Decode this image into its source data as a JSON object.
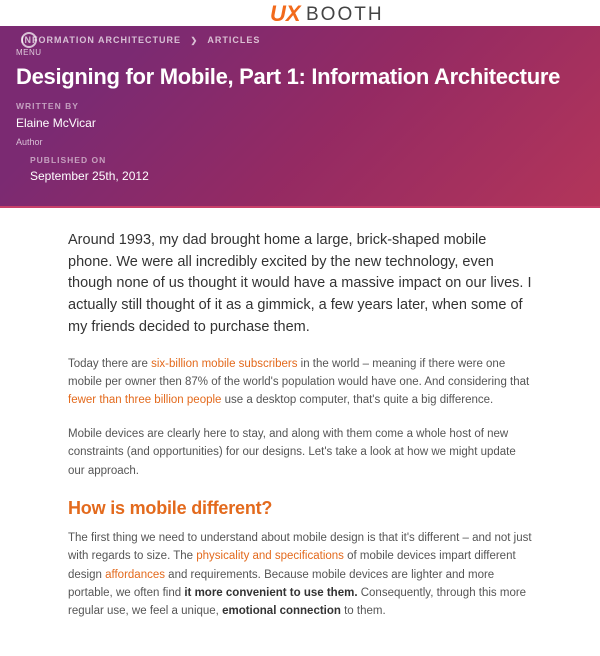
{
  "logo": {
    "mark": "UX",
    "word": "BOOTH"
  },
  "menu": {
    "label": "MENU"
  },
  "breadcrumb": {
    "items": [
      "INFORMATION ARCHITECTURE",
      "ARTICLES"
    ],
    "sep": "❯"
  },
  "title": "Designing for Mobile, Part 1: Information Architecture",
  "meta": {
    "written_by_label": "WRITTEN BY",
    "author_name": "Elaine McVicar",
    "author_role": "Author",
    "published_on_label": "PUBLISHED ON",
    "published_date": "September 25th, 2012"
  },
  "article": {
    "lede": "Around 1993, my dad brought home a large, brick-shaped mobile phone. We were all incredibly excited by the new technology, even though none of us thought it would have a massive impact on our lives. I actually still thought of it as a gimmick, a few years later, when some of my friends decided to purchase them.",
    "p1_a": "Today there are ",
    "p1_link1": "six-billion mobile subscribers",
    "p1_b": " in the world – meaning if there were one mobile per owner then 87% of the world's population would have one. And considering that ",
    "p1_link2": "fewer than three billion people",
    "p1_c": " use a desktop computer, that's quite a big difference.",
    "p2": "Mobile devices are clearly here to stay, and along with them come a whole host of new constraints (and opportunities) for our designs. Let's take a look at how we might update our approach.",
    "h2": "How is mobile different?",
    "p3_a": "The first thing we need to understand about mobile design is that it's different – and not just with regards to size. The ",
    "p3_link1": "physicality and specifications",
    "p3_b": " of mobile devices impart different design ",
    "p3_link2": "affordances",
    "p3_c": " and requirements. Because mobile devices are lighter and more portable, we often find ",
    "p3_bold1": "it more convenient to use them.",
    "p3_d": " Consequently, through this more regular use, we feel a unique, ",
    "p3_bold2": "emotional connection",
    "p3_e": " to them."
  },
  "colors": {
    "accent_orange": "#e36a1d",
    "header_gradient_from": "#7b2a72",
    "header_gradient_to": "#b3355a"
  }
}
